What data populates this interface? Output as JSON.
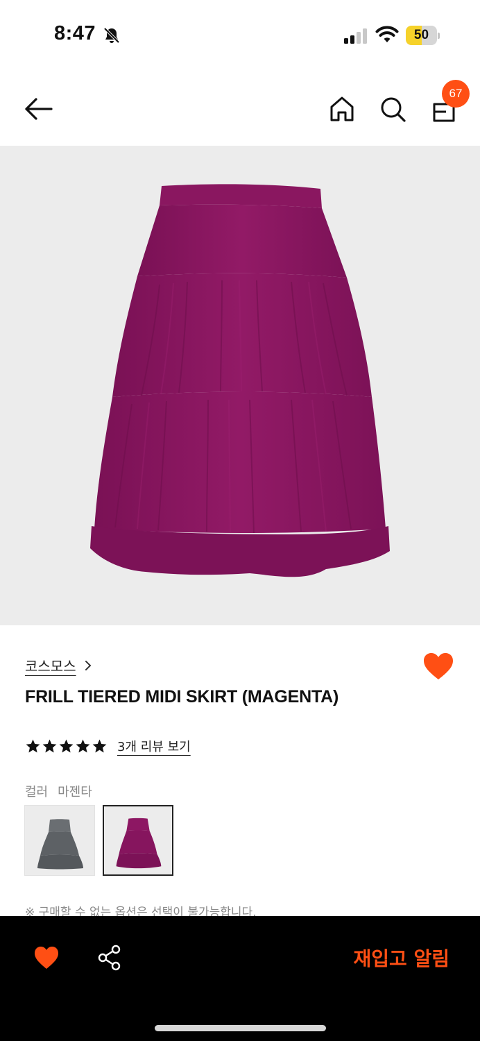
{
  "status_bar": {
    "time": "8:47",
    "battery_level": "50",
    "battery_fraction": 0.5,
    "icons": [
      "bell-slash-icon",
      "signal-icon",
      "wifi-icon",
      "battery-icon"
    ]
  },
  "nav": {
    "icons": [
      "arrow-left-icon",
      "home-icon",
      "search-icon",
      "shopping-bag-icon"
    ],
    "cart_count": "67"
  },
  "product": {
    "brand": "코스모스",
    "name": "FRILL TIERED MIDI SKIRT (MAGENTA)",
    "rating": 5,
    "review_link": "3개 리뷰 보기",
    "color_label": "컬러",
    "color_value": "마젠타",
    "swatches": [
      {
        "name": "gray",
        "color": "#5f6366"
      },
      {
        "name": "magenta",
        "color": "#8d1763",
        "selected": true
      }
    ],
    "notice": "※ 구매할 수 없는 옵션은 선택이 불가능합니다."
  },
  "bottom_bar": {
    "restock_label": "재입고 알림",
    "icons": [
      "heart-icon",
      "share-icon"
    ]
  },
  "colors": {
    "accent": "#ff4f14",
    "skirt": "#8d1763",
    "image_background": "#ececec",
    "bottom_bar": "#000000"
  }
}
